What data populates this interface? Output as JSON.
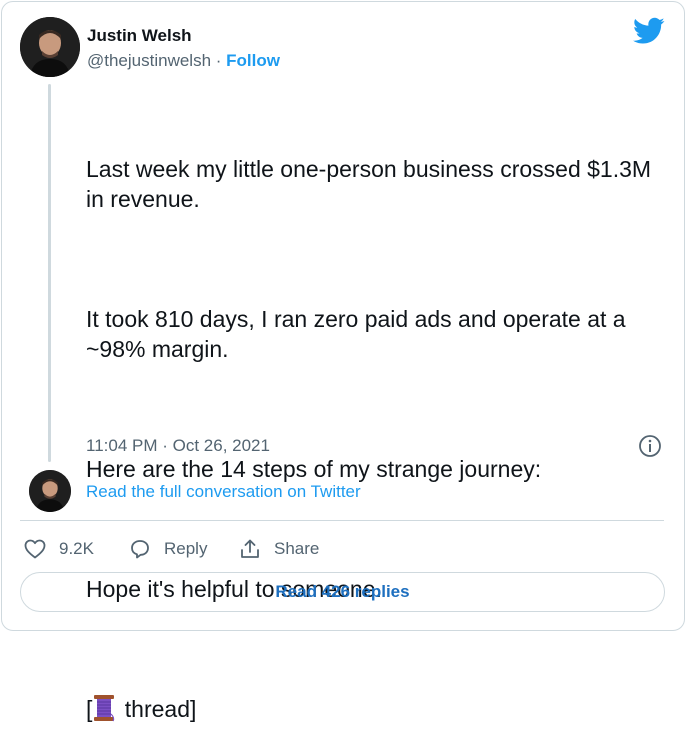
{
  "author": {
    "name": "Justin Welsh",
    "handle": "@thejustinwelsh",
    "separator": " · ",
    "follow_label": "Follow"
  },
  "tweet": {
    "paragraphs": [
      "Last week my little one-person business crossed $1.3M in revenue.",
      "It took 810 days, I ran zero paid ads and operate at a ~98% margin.",
      "Here are the 14 steps of my strange journey:",
      "Hope it's helpful to someone."
    ],
    "thread_open": "[",
    "thread_emoji_name": "spool-of-thread-icon",
    "thread_text": " thread]",
    "timestamp": "11:04 PM · Oct 26, 2021"
  },
  "conversation": {
    "link_label": "Read the full conversation on Twitter"
  },
  "actions": {
    "like_count": "9.2K",
    "reply_label": "Reply",
    "share_label": "Share"
  },
  "footer": {
    "read_replies_label": "Read 426 replies"
  },
  "colors": {
    "accent": "#1d9bf0",
    "text": "#0f1419",
    "muted": "#536471",
    "border": "#cfd9de"
  }
}
